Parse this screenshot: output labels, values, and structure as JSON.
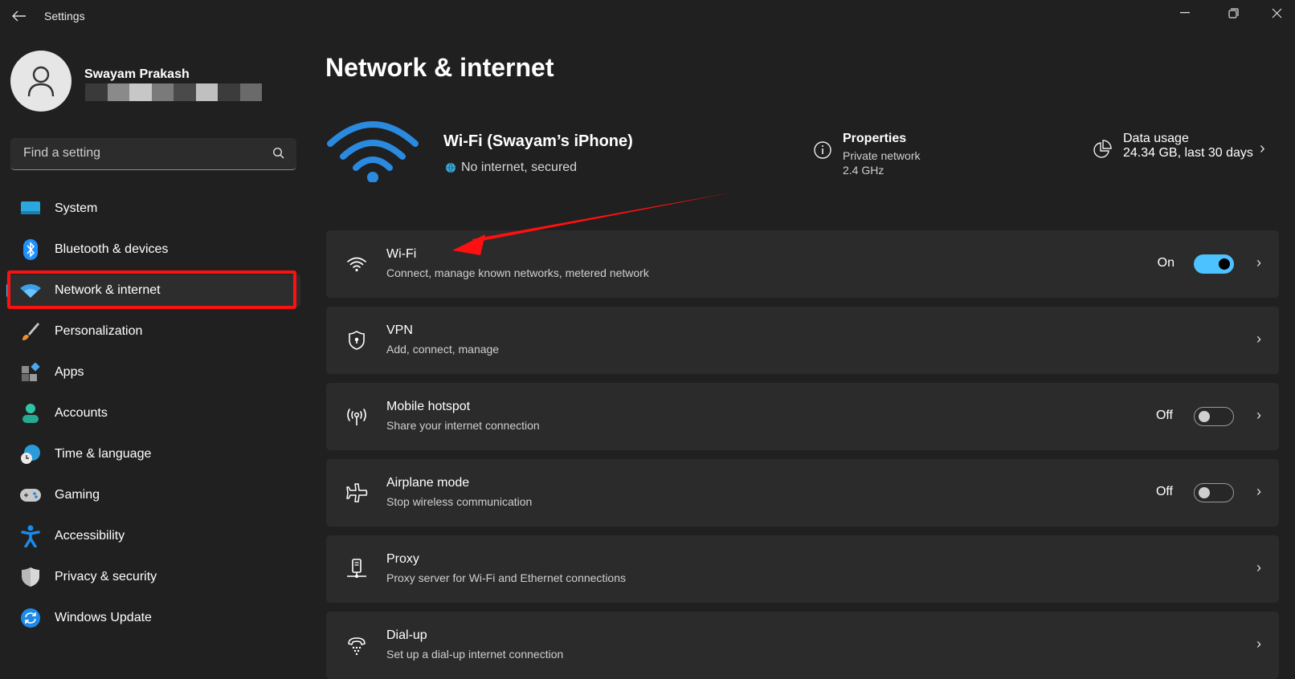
{
  "window": {
    "title": "Settings"
  },
  "user": {
    "name": "Swayam Prakash",
    "email_redacted_shades": [
      "#3a3a3a",
      "#8a8a8a",
      "#c7c7c7",
      "#7a7a7a",
      "#4a4a4a",
      "#c0c0c0",
      "#3c3c3c",
      "#6a6a6a"
    ]
  },
  "search": {
    "placeholder": "Find a setting"
  },
  "nav": {
    "items": [
      {
        "label": "System",
        "icon": "system-icon"
      },
      {
        "label": "Bluetooth & devices",
        "icon": "bluetooth-icon"
      },
      {
        "label": "Network & internet",
        "icon": "network-icon",
        "active": true
      },
      {
        "label": "Personalization",
        "icon": "brush-icon"
      },
      {
        "label": "Apps",
        "icon": "apps-icon"
      },
      {
        "label": "Accounts",
        "icon": "accounts-icon"
      },
      {
        "label": "Time & language",
        "icon": "time-language-icon"
      },
      {
        "label": "Gaming",
        "icon": "gamepad-icon"
      },
      {
        "label": "Accessibility",
        "icon": "accessibility-icon"
      },
      {
        "label": "Privacy & security",
        "icon": "shield-icon"
      },
      {
        "label": "Windows Update",
        "icon": "update-icon"
      }
    ]
  },
  "main": {
    "title": "Network & internet",
    "connection": {
      "name": "Wi-Fi (Swayam’s iPhone)",
      "status": "No internet, secured"
    },
    "properties": {
      "title": "Properties",
      "line1": "Private network",
      "line2": "2.4 GHz"
    },
    "data_usage": {
      "title": "Data usage",
      "value": "24.34 GB, last 30 days"
    },
    "cards": [
      {
        "title": "Wi-Fi",
        "subtitle": "Connect, manage known networks, metered network",
        "state": "On",
        "toggle": true
      },
      {
        "title": "VPN",
        "subtitle": "Add, connect, manage"
      },
      {
        "title": "Mobile hotspot",
        "subtitle": "Share your internet connection",
        "state": "Off",
        "toggle": false
      },
      {
        "title": "Airplane mode",
        "subtitle": "Stop wireless communication",
        "state": "Off",
        "toggle": false
      },
      {
        "title": "Proxy",
        "subtitle": "Proxy server for Wi-Fi and Ethernet connections"
      },
      {
        "title": "Dial-up",
        "subtitle": "Set up a dial-up internet connection"
      }
    ]
  },
  "colors": {
    "accent": "#4cc2ff",
    "annotation": "#ff1010",
    "background": "#202020",
    "card": "#2b2b2b"
  }
}
